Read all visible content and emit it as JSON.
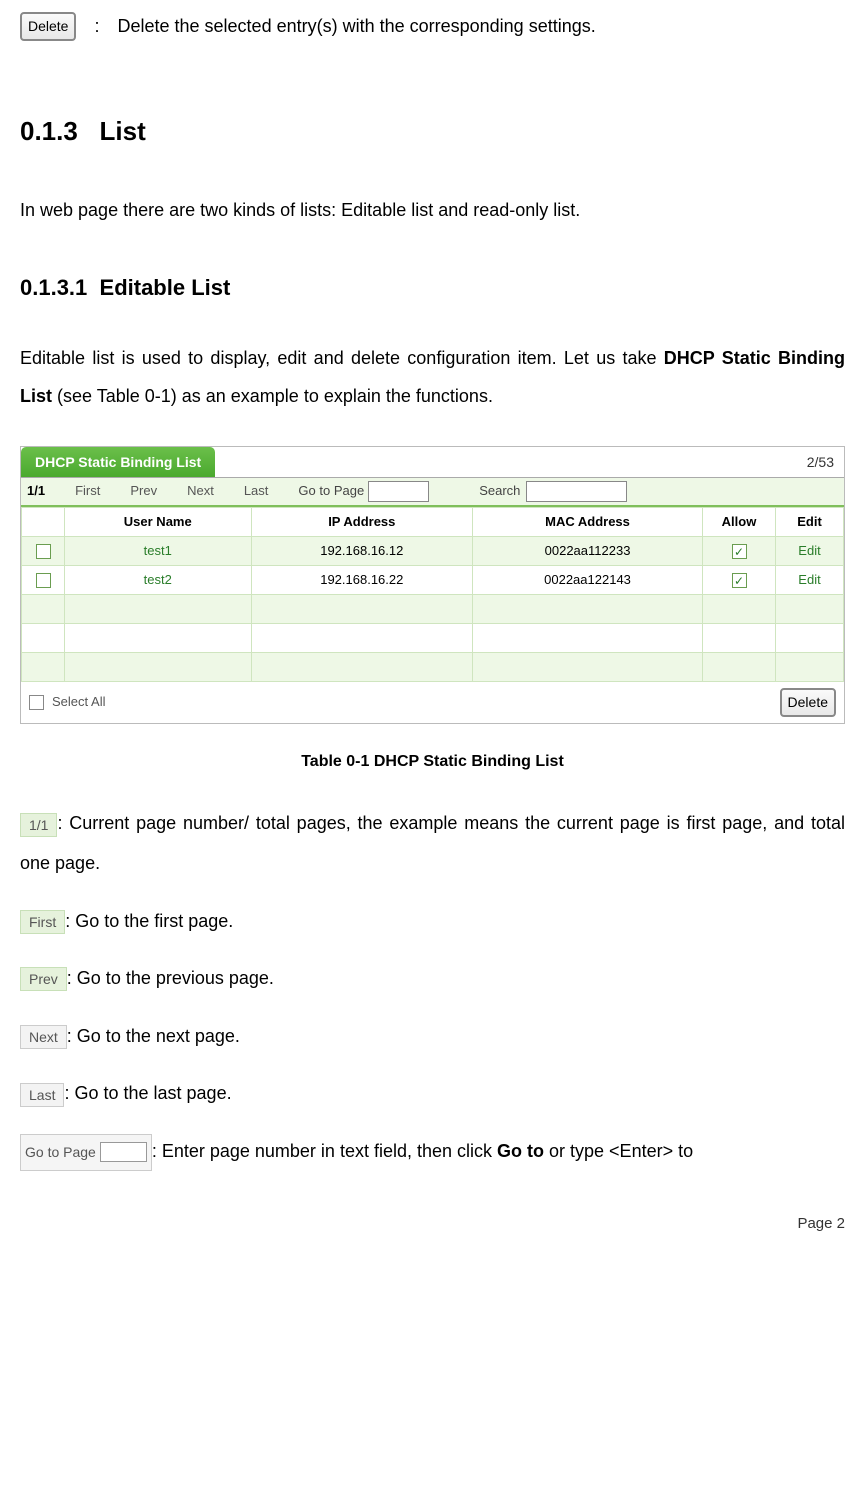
{
  "top": {
    "delete_btn": "Delete",
    "colon": ":",
    "desc": "Delete the selected entry(s) with the corresponding settings."
  },
  "h2_num": "0.1.3",
  "h2_title": "List",
  "intro": "In web page there are two kinds of lists: Editable list and read-only list.",
  "h3_num": "0.1.3.1",
  "h3_title": "Editable List",
  "para_pre": "Editable list is used to display, edit and delete configuration item. Let us take ",
  "para_bold": "DHCP Static Binding List",
  "para_post": " (see Table 0-1) as an example to explain the functions.",
  "table": {
    "tab_title": "DHCP Static Binding List",
    "counter": "2/53",
    "page_ind": "1/1",
    "nav_first": "First",
    "nav_prev": "Prev",
    "nav_next": "Next",
    "nav_last": "Last",
    "goto_label": "Go to Page",
    "search_label": "Search",
    "cols": {
      "user": "User Name",
      "ip": "IP Address",
      "mac": "MAC Address",
      "allow": "Allow",
      "edit": "Edit"
    },
    "rows": [
      {
        "user": "test1",
        "ip": "192.168.16.12",
        "mac": "0022aa112233",
        "allow": true,
        "edit": "Edit"
      },
      {
        "user": "test2",
        "ip": "192.168.16.22",
        "mac": "0022aa122143",
        "allow": true,
        "edit": "Edit"
      }
    ],
    "select_all": "Select All",
    "delete_btn": "Delete"
  },
  "caption": "Table 0-1 DHCP Static Binding List",
  "legend": {
    "pn_chip": "1/1",
    "pn_text": ": Current page number/ total pages, the example means the current page is first page, and total one page.",
    "first_chip": "First",
    "first_text": ": Go to the first page.",
    "prev_chip": "Prev",
    "prev_text": ": Go to the previous page.",
    "next_chip": "Next",
    "next_text": ": Go to the next page.",
    "last_chip": "Last",
    "last_text": ": Go to the last page.",
    "goto_chip": "Go to Page",
    "goto_text_pre": ": Enter page number in text field, then click ",
    "goto_bold": "Go to",
    "goto_text_post": " or type <Enter> to"
  },
  "footer": "Page 2"
}
